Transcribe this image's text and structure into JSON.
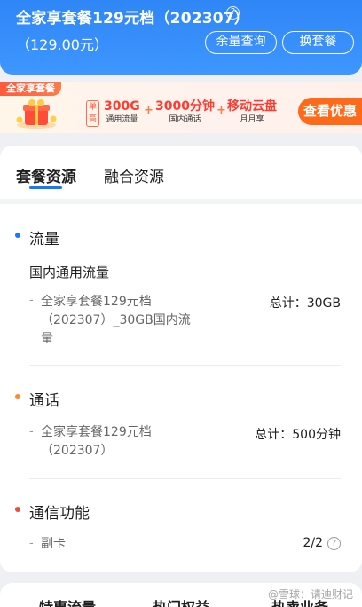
{
  "header": {
    "plan_title": "全家享套餐129元档（202307）",
    "plan_price": "（129.00元）",
    "help_glyph": "?",
    "usage_query_label": "余量查询",
    "change_plan_label": "换套餐"
  },
  "promo": {
    "tag": "全家享套餐",
    "badge": "单高",
    "benefits": [
      {
        "value": "300G",
        "label": "通用流量"
      },
      {
        "value": "3000分钟",
        "label": "国内通话"
      },
      {
        "value": "移动云盘",
        "label": "月月享"
      }
    ],
    "plus": "+",
    "cta": "查看优惠"
  },
  "tabs": [
    "套餐资源",
    "融合资源"
  ],
  "sections": {
    "data": {
      "title": "流量",
      "color": "#1677ff",
      "subhead": "国内通用流量",
      "dash": "-",
      "item": "全家享套餐129元档（202307）_30GB国内流量",
      "total": "总计：30GB"
    },
    "voice": {
      "title": "通话",
      "color": "#ff8a2a",
      "dash": "-",
      "item": "全家享套餐129元档（202307）",
      "total": "总计：500分钟"
    },
    "comm": {
      "title": "通信功能",
      "color": "#f04b3a",
      "dash": "-",
      "item": "副卡",
      "total": "2/2",
      "help_glyph": "?"
    }
  },
  "bottom_tabs": [
    "特惠流量",
    "热门权益",
    "热卖业务"
  ],
  "watermark": "@雪球：请迪财记"
}
